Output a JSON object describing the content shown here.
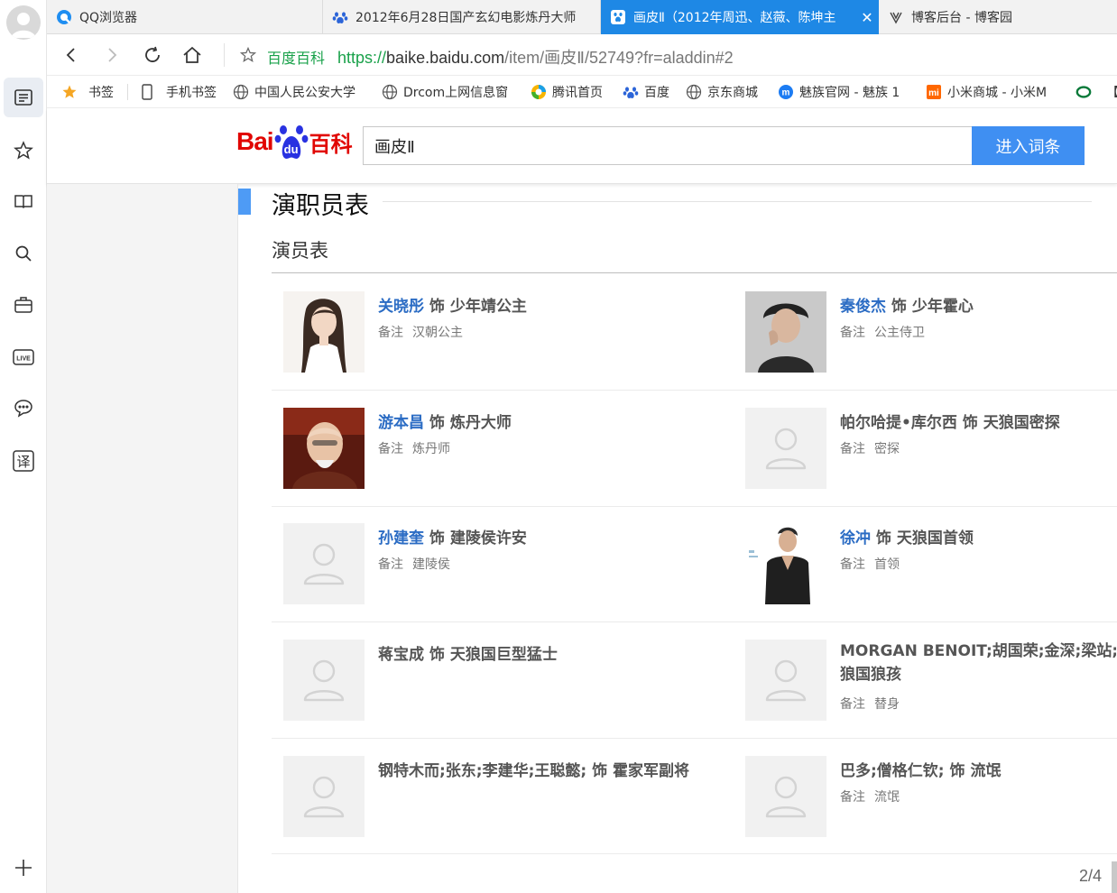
{
  "tabs": [
    {
      "label": "QQ浏览器",
      "icon": "qq-browser-icon",
      "active": false
    },
    {
      "label": "2012年6月28日国产玄幻电影炼丹大师",
      "icon": "baidu-paw-icon",
      "active": false
    },
    {
      "label": "画皮Ⅱ（2012年周迅、赵薇、陈坤主",
      "icon": "baidu-du-icon",
      "active": true,
      "close": "✕"
    },
    {
      "label": "博客后台 - 博客园",
      "icon": "blog-icon",
      "active": false
    }
  ],
  "address": {
    "site_label": "百度百科",
    "protocol": "https://",
    "host": "baike.baidu.com",
    "path": "/item/画皮Ⅱ/52749?fr=aladdin#2"
  },
  "bookmarks": [
    {
      "label": "书签",
      "icon": "star-icon"
    },
    {
      "label": "手机书签",
      "icon": "phone-icon"
    },
    {
      "label": "中国人民公安大学",
      "icon": "globe-icon"
    },
    {
      "label": "Drcom上网信息窗",
      "icon": "globe-icon"
    },
    {
      "label": "腾讯首页",
      "icon": "tencent-icon"
    },
    {
      "label": "百度",
      "icon": "baidu-paw-icon"
    },
    {
      "label": "京东商城",
      "icon": "globe-icon"
    },
    {
      "label": "魅族官网 - 魅族 1",
      "icon": "meizu-icon"
    },
    {
      "label": "小米商城 - 小米M",
      "icon": "mi-icon"
    },
    {
      "label": "【(",
      "icon": "ring-icon"
    }
  ],
  "baike": {
    "logo_bai": "Bai",
    "logo_du": "du",
    "logo_text": "百科",
    "search_value": "画皮Ⅱ",
    "search_button": "进入词条"
  },
  "section": {
    "title": "演职员表",
    "subtitle": "演员表"
  },
  "cast": [
    {
      "actor": "关晓彤",
      "role": "饰 少年靖公主",
      "note_label": "备注",
      "note": "汉朝公主",
      "photo": true,
      "linked": true
    },
    {
      "actor": "秦俊杰",
      "role": "饰 少年霍心",
      "note_label": "备注",
      "note": "公主侍卫",
      "photo": true,
      "linked": true
    },
    {
      "actor": "游本昌",
      "role": "饰 炼丹大师",
      "note_label": "备注",
      "note": "炼丹师",
      "photo": true,
      "linked": true
    },
    {
      "actor": "帕尔哈提•库尔西",
      "role": "饰 天狼国密探",
      "note_label": "备注",
      "note": "密探",
      "photo": false,
      "linked": false
    },
    {
      "actor": "孙建奎",
      "role": "饰 建陵侯许安",
      "note_label": "备注",
      "note": "建陵侯",
      "photo": false,
      "linked": true
    },
    {
      "actor": "徐冲",
      "role": "饰 天狼国首领",
      "note_label": "备注",
      "note": "首领",
      "photo": true,
      "linked": true
    },
    {
      "actor": "蒋宝成",
      "role": "饰 天狼国巨型猛士",
      "note_label": "",
      "note": "",
      "photo": false,
      "linked": false
    },
    {
      "actor": "MORGAN BENOIT;胡国荣;金深;梁站;",
      "role": "狼国狼孩",
      "note_label": "备注",
      "note": "替身",
      "photo": false,
      "linked": false
    },
    {
      "actor": "钢特木而;张东;李建华;王聪懿;",
      "role": "饰 霍家军副将",
      "note_label": "",
      "note": "",
      "photo": false,
      "linked": false
    },
    {
      "actor": "巴多;僧格仁钦;",
      "role": "饰 流氓",
      "note_label": "备注",
      "note": "流氓",
      "photo": false,
      "linked": false
    }
  ],
  "pager": "2/4"
}
